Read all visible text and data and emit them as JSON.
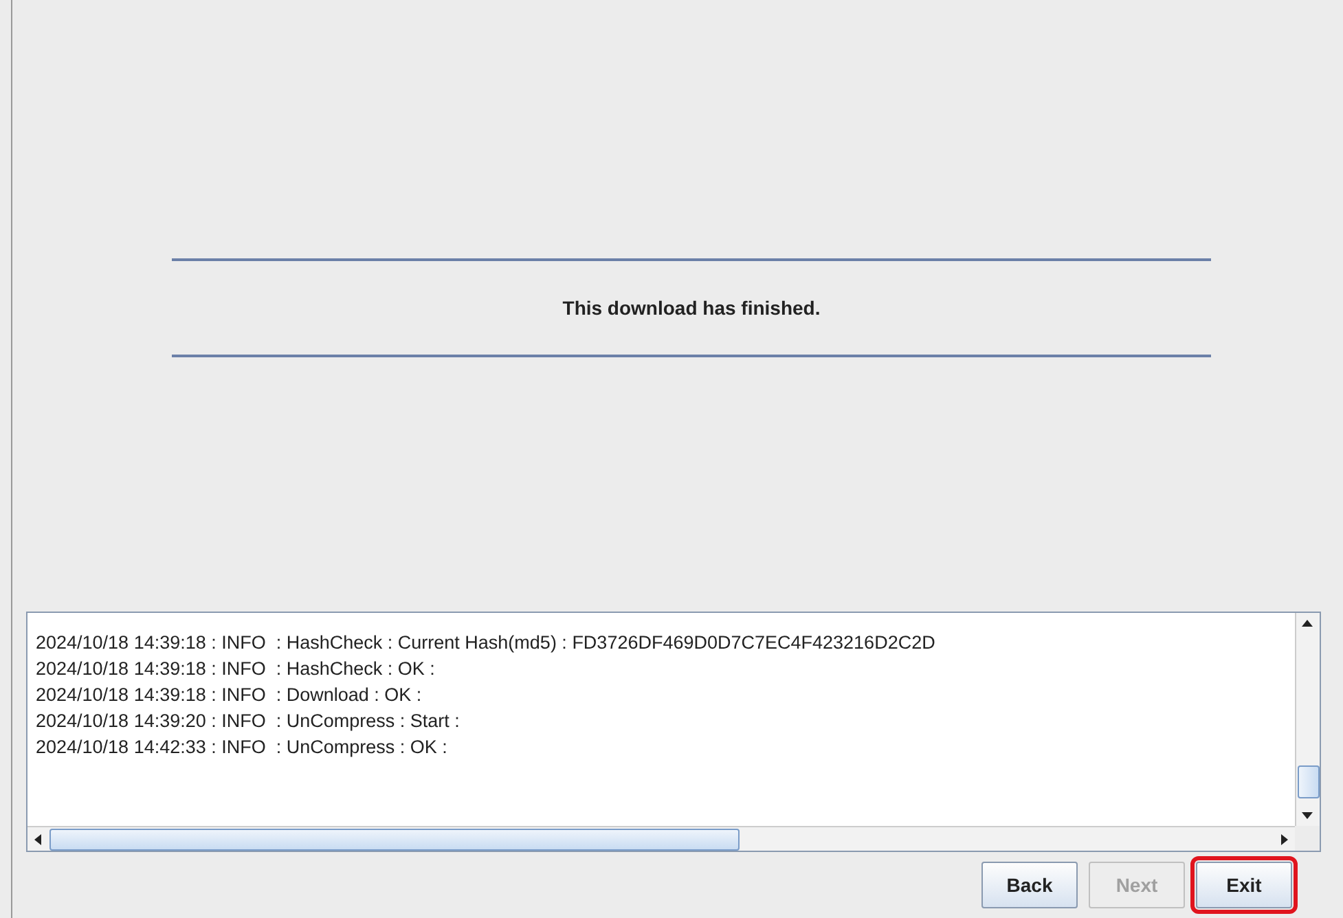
{
  "message": "This download has finished.",
  "log": {
    "lines": [
      "2024/10/18 14:39:18 : INFO  : HashCheck : Current Hash(md5) : FD3726DF469D0D7C7EC4F423216D2C2D",
      "2024/10/18 14:39:18 : INFO  : HashCheck : OK :",
      "2024/10/18 14:39:18 : INFO  : Download : OK :",
      "2024/10/18 14:39:20 : INFO  : UnCompress : Start :",
      "2024/10/18 14:42:33 : INFO  : UnCompress : OK :"
    ]
  },
  "buttons": [
    {
      "label": "Back",
      "disabled": false,
      "highlighted": false
    },
    {
      "label": "Next",
      "disabled": true,
      "highlighted": false
    },
    {
      "label": "Exit",
      "disabled": false,
      "highlighted": true
    }
  ]
}
